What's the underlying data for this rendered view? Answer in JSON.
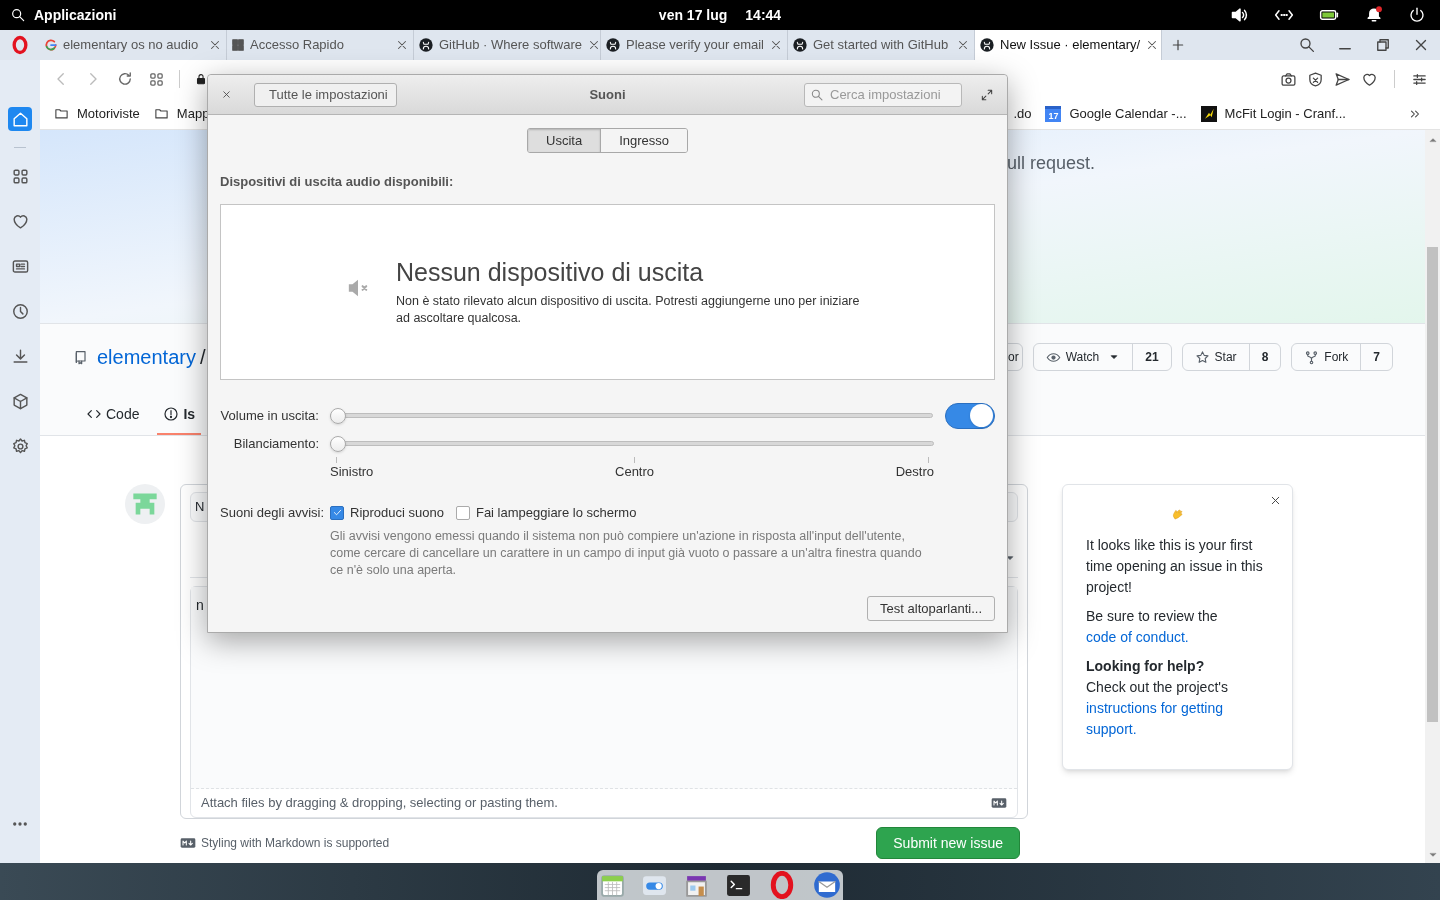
{
  "top_panel": {
    "menu_label": "Applicazioni",
    "date": "ven 17 lug",
    "time": "14:44"
  },
  "browser": {
    "tabs": [
      {
        "kind": "google",
        "title": "elementary os no audio",
        "selected": false
      },
      {
        "kind": "speed_dial",
        "title": "Accesso Rapido",
        "selected": false
      },
      {
        "kind": "github",
        "title": "GitHub · Where software",
        "selected": false
      },
      {
        "kind": "github",
        "title": "Please verify your email",
        "selected": false
      },
      {
        "kind": "github",
        "title": "Get started with GitHub",
        "selected": false
      },
      {
        "kind": "github",
        "title": "New Issue · elementary/",
        "selected": true
      }
    ],
    "bookmarks_left": [
      {
        "kind": "folder",
        "title": "Motoriviste"
      },
      {
        "kind": "folder",
        "title": "Mapp"
      }
    ],
    "bookmarks_right": [
      {
        "kind": "plain",
        "title": ".do"
      },
      {
        "kind": "calendar",
        "title": "Google Calendar -...",
        "badge": "17"
      },
      {
        "kind": "mcfit",
        "title": "McFit Login - Cranf..."
      }
    ],
    "sidebar": [
      {
        "kind": "home",
        "selected": true
      },
      {
        "kind": "speed_dial",
        "selected": false
      },
      {
        "kind": "heart",
        "selected": false
      },
      {
        "kind": "news",
        "selected": false
      },
      {
        "kind": "history",
        "selected": false
      },
      {
        "kind": "downloads",
        "selected": false
      },
      {
        "kind": "extensions",
        "selected": false
      },
      {
        "kind": "settings",
        "selected": false
      }
    ]
  },
  "page": {
    "banner_text": "ull request.",
    "repo_owner": "elementary",
    "repo_separator": "/",
    "partial_button": "or",
    "counters": [
      {
        "kind": "watch",
        "label": "Watch",
        "count": "21",
        "dropdown": true
      },
      {
        "kind": "star",
        "label": "Star",
        "count": "8",
        "dropdown": false
      },
      {
        "kind": "fork",
        "label": "Fork",
        "count": "7",
        "dropdown": false
      }
    ],
    "repo_tabs": [
      {
        "kind": "code",
        "label": "Code",
        "selected": false
      },
      {
        "kind": "issues",
        "label": "Is",
        "selected": true
      }
    ],
    "issue_form": {
      "title_value": "N",
      "body_value": "n",
      "attach_hint": "Attach files by dragging & dropping, selecting or pasting them.",
      "markdown_note": "Styling with Markdown is supported",
      "submit_label": "Submit new issue"
    },
    "help_card": {
      "intro": "It looks like this is your first time opening an issue in this project!",
      "review_text": "Be sure to review the",
      "review_link": "code of conduct.",
      "help_heading": "Looking for help?",
      "help_text": "Check out the project's",
      "help_link": "instructions for getting support."
    }
  },
  "dialog": {
    "title": "Suoni",
    "back_label": "Tutte le impostazioni",
    "search_placeholder": "Cerca impostazioni",
    "tabs": [
      {
        "label": "Uscita",
        "selected": true
      },
      {
        "label": "Ingresso",
        "selected": false
      }
    ],
    "devices_heading": "Dispositivi di uscita audio disponibili:",
    "empty_title": "Nessun dispositivo di uscita",
    "empty_text": "Non è stato rilevato alcun dispositivo di uscita. Potresti aggiungerne uno per iniziare ad ascoltare qualcosa.",
    "volume": {
      "label": "Volume in uscita:",
      "level": 0,
      "on": true
    },
    "balance": {
      "label": "Bilanciamento:",
      "level": 0,
      "marks": [
        "Sinistro",
        "Centro",
        "Destro"
      ]
    },
    "alerts": {
      "label": "Suoni degli avvisi:",
      "options": [
        {
          "label": "Riproduci suono",
          "checked": true
        },
        {
          "label": "Fai lampeggiare lo schermo",
          "checked": false
        }
      ],
      "description": "Gli avvisi vengono emessi quando il sistema non può compiere un'azione in risposta all'input dell'utente, come cercare di cancellare un carattere in un campo di input già vuoto o passare a un'altra finestra quando ce n'è solo una aperta."
    },
    "test_button": "Test altoparlanti..."
  }
}
